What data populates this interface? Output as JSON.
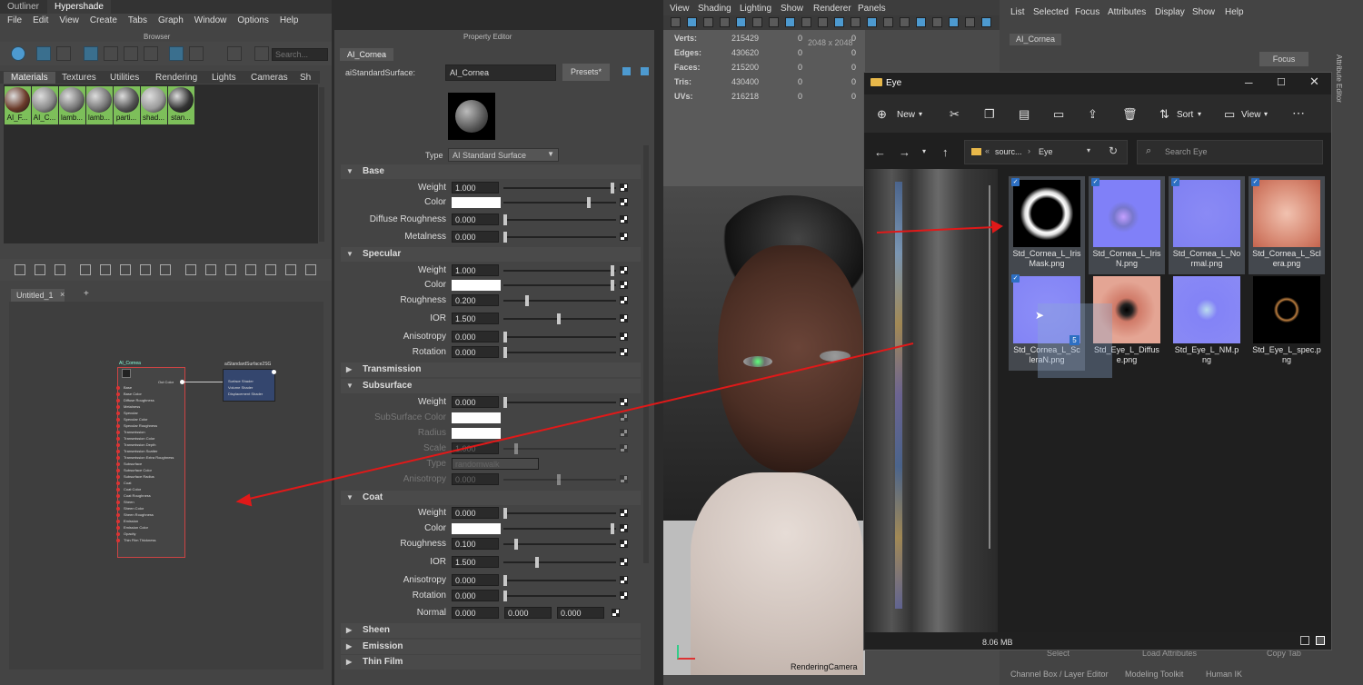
{
  "top_tabs": [
    "Outliner",
    "Hypershade"
  ],
  "hypershade_menu": [
    "File",
    "Edit",
    "View",
    "Create",
    "Tabs",
    "Graph",
    "Window",
    "Options",
    "Help"
  ],
  "browser": {
    "title": "Browser",
    "search_placeholder": "Search...",
    "tabs": [
      "Materials",
      "Textures",
      "Utilities",
      "Rendering",
      "Lights",
      "Cameras",
      "Sh"
    ],
    "swatches": [
      {
        "label": "AI_F...",
        "color": "#6b3b2a"
      },
      {
        "label": "AI_C...",
        "color": "#8a8a8a"
      },
      {
        "label": "lamb...",
        "color": "#777777"
      },
      {
        "label": "lamb...",
        "color": "#777777"
      },
      {
        "label": "parti...",
        "color": "#555555"
      },
      {
        "label": "shad...",
        "color": "#9a9a9a"
      },
      {
        "label": "stan...",
        "color": "#333333"
      }
    ]
  },
  "graph": {
    "tab_label": "Untitled_1",
    "add_tab": "+",
    "node1": {
      "title": "AI_Cornea",
      "out": "Out Color",
      "rows": [
        "Base",
        "Base Color",
        "Diffuse Roughness",
        "Metalness",
        "Specular",
        "Specular Color",
        "Specular Roughness",
        "Transmission",
        "Transmission Color",
        "Transmission Depth",
        "Transmission Scatter",
        "Transmission Extra Roughness",
        "Subsurface",
        "Subsurface Color",
        "Subsurface Radius",
        "Coat",
        "Coat Color",
        "Coat Roughness",
        "Sheen",
        "Sheen Color",
        "Sheen Roughness",
        "Emission",
        "Emission Color",
        "Opacity",
        "Thin Film Thickness"
      ]
    },
    "node2": {
      "title": "aiStandardSurface2SG",
      "rows": [
        "Surface Shader",
        "Volume Shader",
        "Displacement Shader"
      ]
    }
  },
  "property_editor": {
    "title": "Property Editor",
    "tab": "AI_Cornea",
    "type_label": "aiStandardSurface:",
    "name_value": "AI_Cornea",
    "presets": "Presets*",
    "type_field_label": "Type",
    "type_value": "AI Standard Surface",
    "sections": {
      "base": "Base",
      "specular": "Specular",
      "transmission": "Transmission",
      "subsurface": "Subsurface",
      "coat": "Coat",
      "sheen": "Sheen",
      "emission": "Emission",
      "thin_film": "Thin Film"
    },
    "base": {
      "weight": {
        "label": "Weight",
        "value": "1.000",
        "level": 1.0
      },
      "color": {
        "label": "Color",
        "level": 0.78
      },
      "diffuse_roughness": {
        "label": "Diffuse Roughness",
        "value": "0.000",
        "level": 0.0
      },
      "metalness": {
        "label": "Metalness",
        "value": "0.000",
        "level": 0.0
      }
    },
    "specular": {
      "weight": {
        "label": "Weight",
        "value": "1.000",
        "level": 1.0
      },
      "color": {
        "label": "Color",
        "level": 1.0
      },
      "roughness": {
        "label": "Roughness",
        "value": "0.200",
        "level": 0.2
      },
      "ior": {
        "label": "IOR",
        "value": "1.500",
        "level": 0.5
      },
      "anisotropy": {
        "label": "Anisotropy",
        "value": "0.000",
        "level": 0.0
      },
      "rotation": {
        "label": "Rotation",
        "value": "0.000",
        "level": 0.0
      }
    },
    "subsurface": {
      "weight": {
        "label": "Weight",
        "value": "0.000",
        "level": 0.0
      },
      "color": {
        "label": "SubSurface Color"
      },
      "radius": {
        "label": "Radius"
      },
      "scale": {
        "label": "Scale",
        "value": "1.000"
      },
      "type": {
        "label": "Type",
        "value": "randomwalk"
      },
      "anisotropy": {
        "label": "Anisotropy",
        "value": "0.000"
      }
    },
    "coat": {
      "weight": {
        "label": "Weight",
        "value": "0.000",
        "level": 0.0
      },
      "color": {
        "label": "Color",
        "level": 1.0
      },
      "roughness": {
        "label": "Roughness",
        "value": "0.100",
        "level": 0.1
      },
      "ior": {
        "label": "IOR",
        "value": "1.500",
        "level": 0.3
      },
      "anisotropy": {
        "label": "Anisotropy",
        "value": "0.000",
        "level": 0.0
      },
      "rotation": {
        "label": "Rotation",
        "value": "0.000",
        "level": 0.0
      },
      "normal": {
        "label": "Normal",
        "x": "0.000",
        "y": "0.000",
        "z": "0.000"
      }
    }
  },
  "viewport": {
    "menu": [
      "View",
      "Shading",
      "Lighting",
      "Show",
      "Renderer",
      "Panels"
    ],
    "stats": [
      {
        "label": "Verts:",
        "a": "215429",
        "b": "0",
        "c": "0"
      },
      {
        "label": "Edges:",
        "a": "430620",
        "b": "0",
        "c": "0"
      },
      {
        "label": "Faces:",
        "a": "215200",
        "b": "0",
        "c": "0"
      },
      {
        "label": "Tris:",
        "a": "430400",
        "b": "0",
        "c": "0"
      },
      {
        "label": "UVs:",
        "a": "216218",
        "b": "0",
        "c": "0"
      }
    ],
    "resolution": "2048 x 2048",
    "camera": "RenderingCamera"
  },
  "attribute_editor": {
    "menu": [
      "List",
      "Selected",
      "Focus",
      "Attributes",
      "Display",
      "Show",
      "Help"
    ],
    "tab": "AI_Cornea",
    "focus_button": "Focus",
    "side_label": "Attribute Editor",
    "bottom_buttons": [
      "Select",
      "Load Attributes",
      "Copy Tab"
    ],
    "bottom_tabs": [
      "Channel Box / Layer Editor",
      "Modeling Toolkit",
      "Human IK"
    ]
  },
  "explorer": {
    "title": "Eye",
    "toolbar": {
      "new": "New",
      "sort": "Sort",
      "view": "View"
    },
    "breadcrumb": [
      "sourc...",
      "Eye"
    ],
    "search_placeholder": "Search Eye",
    "status": "8.06 MB",
    "files": [
      {
        "name": "Std_Cornea_L_IrisMask.png",
        "line1": "Std_Cornea_L_Iris",
        "line2": "Mask.png",
        "selected": true
      },
      {
        "name": "Std_Cornea_L_IrisN.png",
        "line1": "Std_Cornea_L_Iris",
        "line2": "N.png",
        "selected": true
      },
      {
        "name": "Std_Cornea_L_Normal.png",
        "line1": "Std_Cornea_L_No",
        "line2": "rmal.png",
        "selected": true
      },
      {
        "name": "Std_Cornea_L_Sclera.png",
        "line1": "Std_Cornea_L_Scl",
        "line2": "era.png",
        "selected": true
      },
      {
        "name": "Std_Cornea_L_ScleraN.png",
        "line1": "Std_Cornea_L_Sc",
        "line2": "leraN.png",
        "selected": true
      },
      {
        "name": "Std_Eye_L_Diffuse.png",
        "line1": "Std_Eye_L_Diffus",
        "line2": "e.png",
        "selected": false
      },
      {
        "name": "Std_Eye_L_NM.png",
        "line1": "Std_Eye_L_NM.p",
        "line2": "ng",
        "selected": false
      },
      {
        "name": "Std_Eye_L_spec.png",
        "line1": "Std_Eye_L_spec.p",
        "line2": "ng",
        "selected": false
      }
    ],
    "drag_count": "5"
  }
}
